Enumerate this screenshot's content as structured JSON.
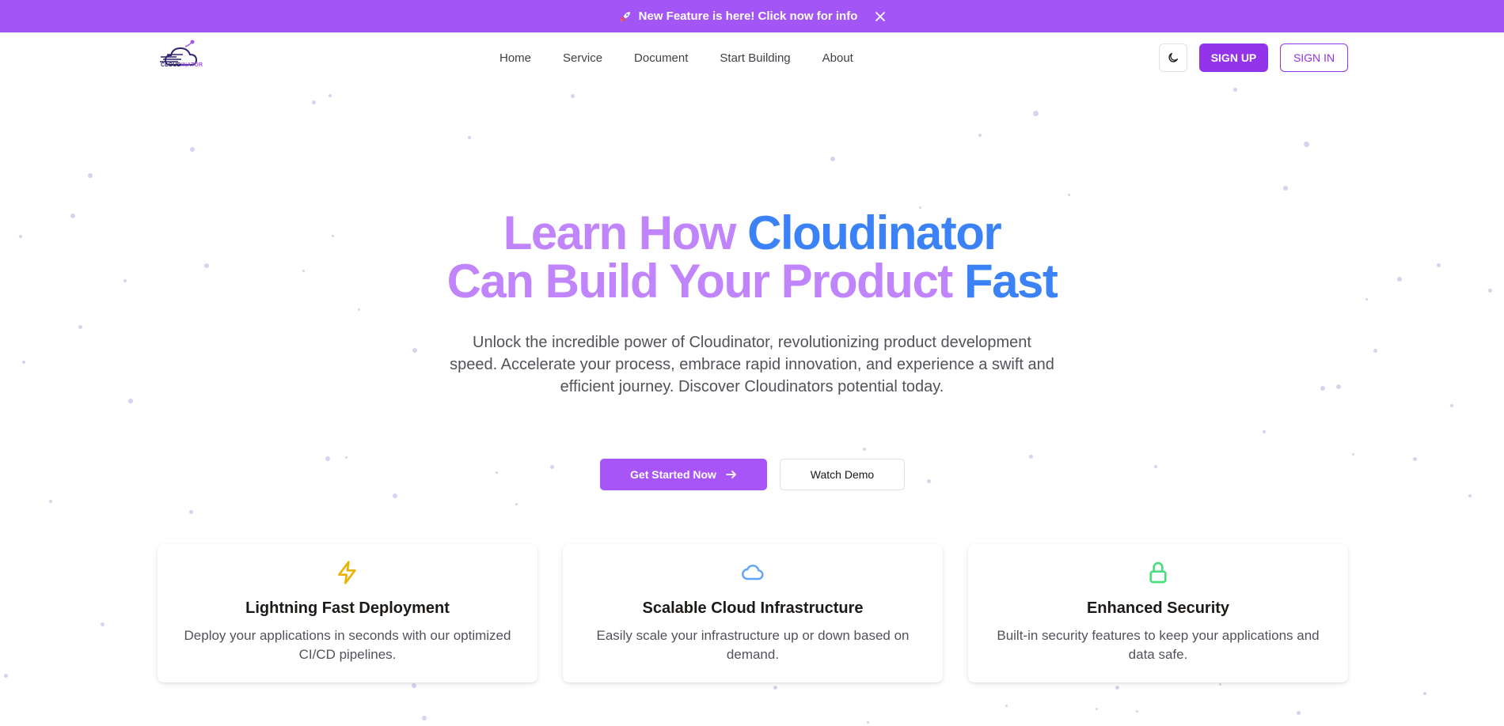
{
  "banner": {
    "text": "New Feature is here! Click now for info",
    "rocket_icon": "rocket-icon",
    "close_icon": "close-icon"
  },
  "logo": {
    "part1": "CLOUD",
    "part2": "INATOR"
  },
  "nav": {
    "items": [
      "Home",
      "Service",
      "Document",
      "Start Building",
      "About"
    ]
  },
  "header": {
    "theme_icon": "moon-icon",
    "signup": "SIGN UP",
    "signin": "SIGN IN"
  },
  "hero": {
    "title_line1_a": "Learn How ",
    "title_line1_b": "Cloudinator",
    "title_line2_a": "Can Build Your Product ",
    "title_line2_b": "Fast",
    "subtitle": "Unlock the incredible power of Cloudinator, revolutionizing product development speed. Accelerate your process, embrace rapid innovation, and experience a swift and efficient journey. Discover Cloudinators potential today.",
    "primary_cta": "Get Started Now",
    "secondary_cta": "Watch Demo"
  },
  "features": [
    {
      "title": "Lightning Fast Deployment",
      "desc": "Deploy your applications in seconds with our optimized CI/CD pipelines.",
      "icon": "lightning-icon"
    },
    {
      "title": "Scalable Cloud Infrastructure",
      "desc": "Easily scale your infrastructure up or down based on demand.",
      "icon": "cloud-icon"
    },
    {
      "title": "Enhanced Security",
      "desc": "Built-in security features to keep your applications and data safe.",
      "icon": "lock-icon"
    }
  ],
  "colors": {
    "brand_purple": "#a455f5",
    "title_purple": "#c084fc",
    "title_blue": "#3b82f6",
    "signup_purple": "#9333ea",
    "lightning": "#eab308",
    "cloud": "#60a5fa",
    "lock": "#4ade80"
  }
}
